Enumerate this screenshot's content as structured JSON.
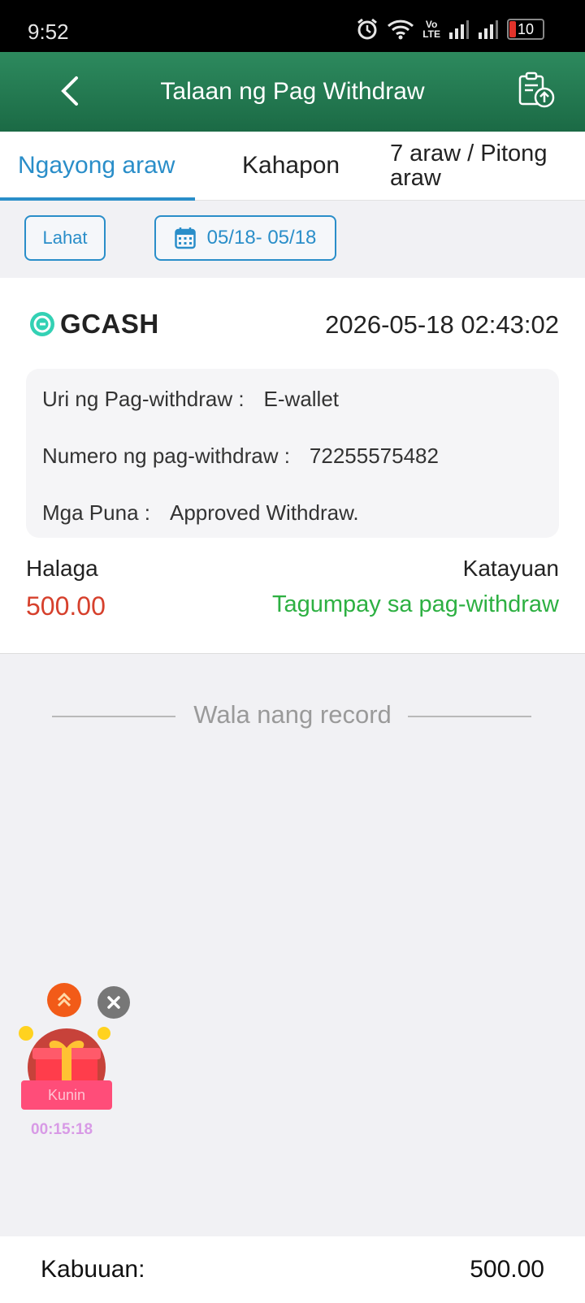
{
  "status_bar": {
    "time": "9:52",
    "battery": "10"
  },
  "header": {
    "title": "Talaan ng Pag Withdraw"
  },
  "tabs": [
    {
      "label": "Ngayong araw",
      "active": true
    },
    {
      "label": "Kahapon"
    },
    {
      "label": "7 araw / Pitong araw"
    }
  ],
  "filters": {
    "all_label": "Lahat",
    "date_range": "05/18- 05/18"
  },
  "record": {
    "provider": "GCASH",
    "datetime": "2026-05-18 02:43:02",
    "type_label": "Uri ng Pag-withdraw :",
    "type_value": "E-wallet",
    "number_label": "Numero ng pag-withdraw :",
    "number_value": "72255575482",
    "remarks_label": "Mga Puna :",
    "remarks_value": "Approved Withdraw.",
    "amount_label": "Halaga",
    "amount": "500.00",
    "status_label": "Katayuan",
    "status": "Tagumpay sa pag-withdraw"
  },
  "empty_text": "Wala nang record",
  "floating_gift": {
    "label": "Kunin",
    "timer": "00:15:18"
  },
  "footer": {
    "total_label": "Kabuuan:",
    "total_value": "500.00"
  },
  "colors": {
    "header": "#1f734c",
    "accent": "#2a8ec9",
    "amount": "#d6402c",
    "success": "#2db042"
  }
}
